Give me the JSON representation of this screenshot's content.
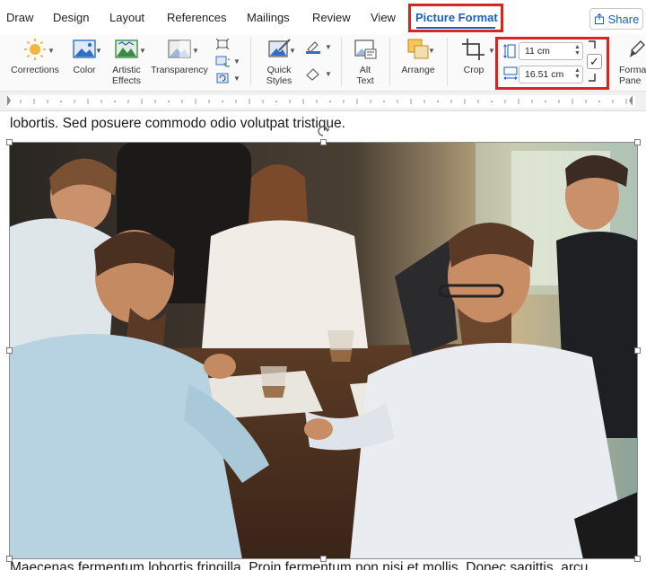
{
  "tabs": [
    {
      "label": "Draw"
    },
    {
      "label": "Design"
    },
    {
      "label": "Layout"
    },
    {
      "label": "References"
    },
    {
      "label": "Mailings"
    },
    {
      "label": "Review"
    },
    {
      "label": "View"
    },
    {
      "label": "Picture Format"
    }
  ],
  "share": {
    "label": "Share"
  },
  "ribbon": {
    "corrections": "Corrections",
    "color": "Color",
    "artistic_effects_1": "Artistic",
    "artistic_effects_2": "Effects",
    "transparency": "Transparency",
    "quick_styles_1": "Quick",
    "quick_styles_2": "Styles",
    "alt_text_1": "Alt",
    "alt_text_2": "Text",
    "arrange": "Arrange",
    "crop": "Crop",
    "format_pane_1": "Forma",
    "format_pane_2": "Pane"
  },
  "size": {
    "height": "11 cm",
    "width": "16.51 cm"
  },
  "document": {
    "line_above": "lobortis. Sed posuere commodo odio volutpat tristique.",
    "line_below": "Maecenas fermentum lobortis fringilla. Proin fermentum non nisi et mollis. Donec sagittis, arcu"
  },
  "colors": {
    "accent": "#1b5fbf",
    "highlight": "#d8261e"
  }
}
